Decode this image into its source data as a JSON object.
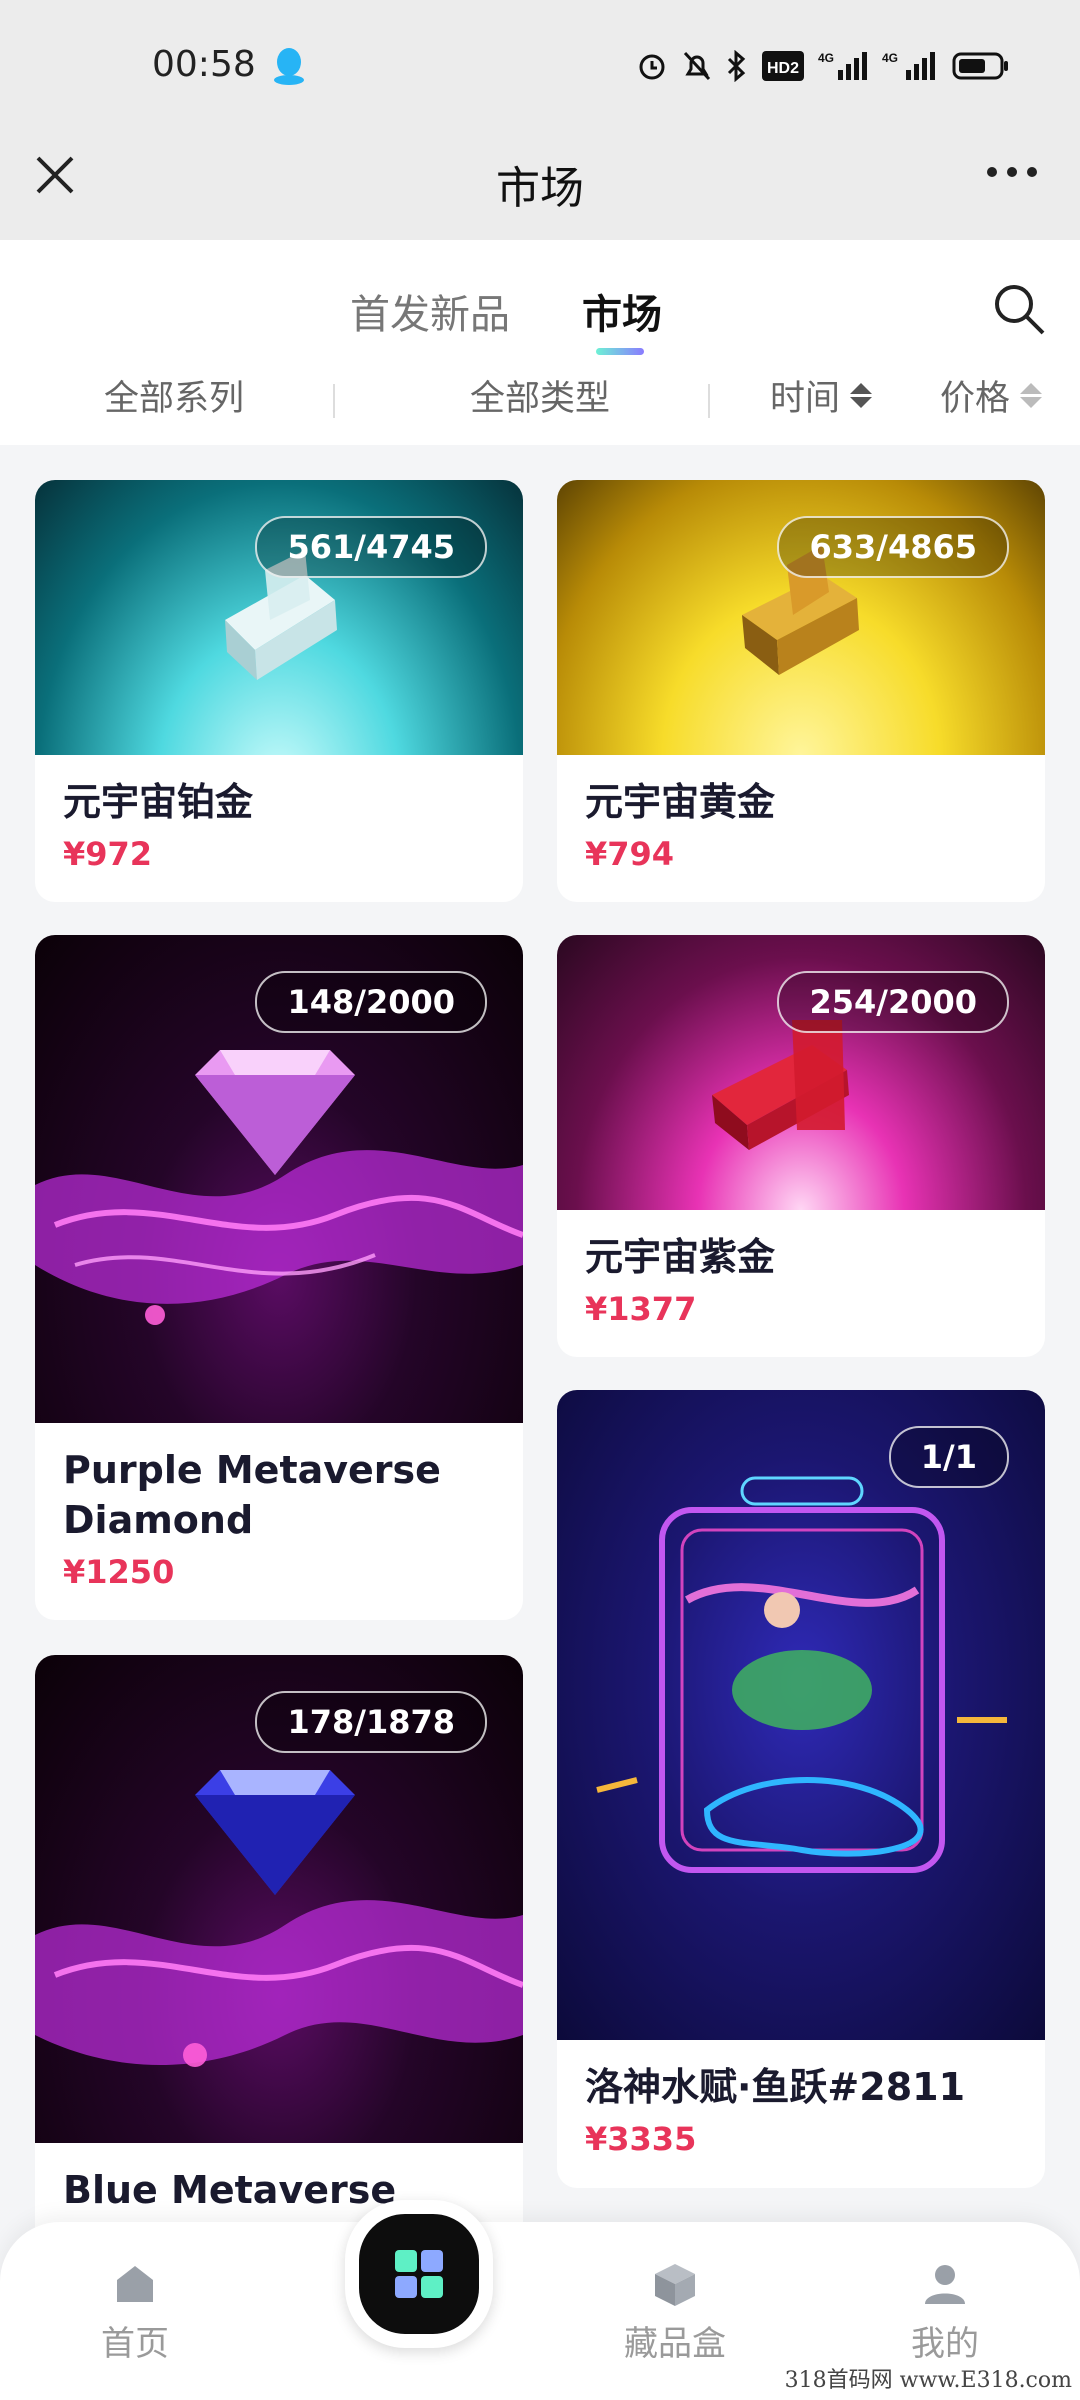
{
  "status_bar": {
    "time": "00:58",
    "network_1": "4G",
    "network_2": "4G",
    "hd": "HD2"
  },
  "header": {
    "title": "市场"
  },
  "tabs": [
    {
      "label": "首发新品"
    },
    {
      "label": "市场"
    }
  ],
  "filters": {
    "series": "全部系列",
    "type": "全部类型",
    "time": "时间",
    "price": "价格"
  },
  "products": [
    {
      "name": "元宇宙铂金",
      "price": "¥972",
      "badge": "561/4745",
      "theme": "platinum",
      "colors": [
        "#4fd9e0",
        "#0a6f7a"
      ]
    },
    {
      "name": "元宇宙黄金",
      "price": "¥794",
      "badge": "633/4865",
      "theme": "gold",
      "colors": [
        "#f7dc2a",
        "#b88b07"
      ]
    },
    {
      "name": "Purple Metaverse Diamond",
      "price": "¥1250",
      "badge": "148/2000",
      "theme": "purple-diamond",
      "colors": [
        "#e04bf2",
        "#120216"
      ]
    },
    {
      "name": "元宇宙紫金",
      "price": "¥1377",
      "badge": "254/2000",
      "theme": "purple-gold",
      "colors": [
        "#e832b4",
        "#2a0820"
      ]
    },
    {
      "name": "Blue Metaverse",
      "price": "",
      "badge": "178/1878",
      "theme": "blue-diamond",
      "colors": [
        "#d83ef2",
        "#120216"
      ]
    },
    {
      "name": "洛神水赋·鱼跃#2811",
      "price": "¥3335",
      "badge": "1/1",
      "theme": "luoshen",
      "colors": [
        "#2f2ab8",
        "#0c0a3a"
      ]
    }
  ],
  "bottom_nav": {
    "home": "首页",
    "box": "藏品盒",
    "me": "我的"
  },
  "watermark": "318首码网 www.E318.com"
}
